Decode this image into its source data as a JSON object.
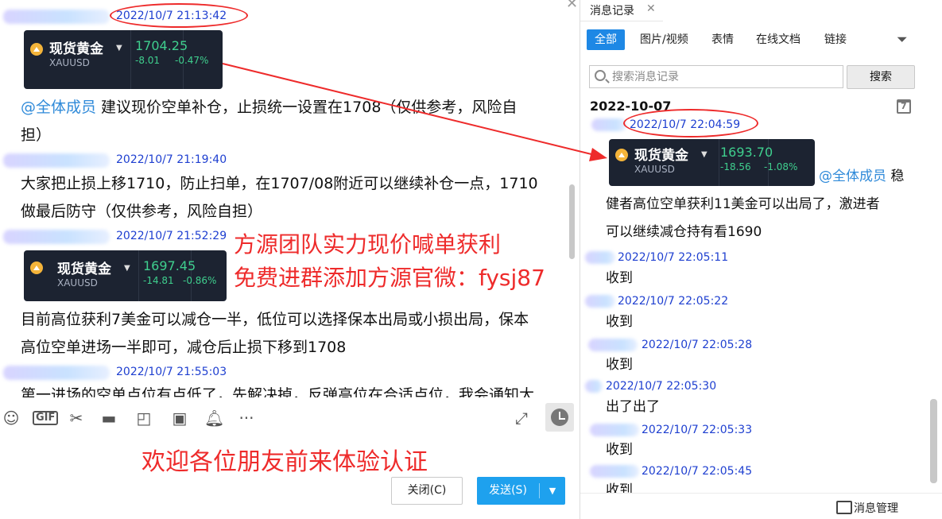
{
  "chat": {
    "messages": [
      {
        "timestamp": "2022/10/7 21:13:42",
        "card": {
          "name": "现货黄金",
          "code": "XAUUSD",
          "price": "1704.25",
          "change": "-8.01",
          "change_pct": "-0.47%"
        },
        "text_parts": [
          "@全体成员",
          " 建议现价空单补仓，止损统一设置在1708（仅供参考，风险自",
          "担）"
        ]
      },
      {
        "timestamp": "2022/10/7 21:19:40",
        "text_lines": [
          "大家把止损上移1710，防止扫单，在1707/08附近可以继续补仓一点，1710",
          "做最后防守（仅供参考，风险自担）"
        ]
      },
      {
        "timestamp": "2022/10/7 21:52:29",
        "card": {
          "name": "现货黄金",
          "code": "XAUUSD",
          "price": "1697.45",
          "change": "-14.81",
          "change_pct": "-0.86%"
        },
        "text_lines": [
          "目前高位获利7美金可以减仓一半，低位可以选择保本出局或小损出局，保本",
          "高位空单进场一半即可，减仓后止损下移到1708"
        ]
      },
      {
        "timestamp": "2022/10/7 21:55:03",
        "text_lines": [
          "第一进场的空单点位有点低了，先解决掉，反弹高位在合适点位，我会通知大"
        ]
      }
    ],
    "promo_lines": [
      "方源团队实力现价喊单获利",
      "免费进群添加方源官微：fysj87"
    ],
    "welcome": "欢迎各位朋友前来体验认证",
    "close_label": "关闭(C)",
    "send_label": "发送(S)",
    "toolbar_icons": [
      "emoji-icon",
      "gif-icon",
      "scissors-icon",
      "folder-icon",
      "screenshot-icon",
      "image-icon",
      "bell-icon",
      "more-icon"
    ]
  },
  "history": {
    "tab_title": "消息记录",
    "filters": [
      "全部",
      "图片/视频",
      "表情",
      "在线文档",
      "链接"
    ],
    "search_placeholder": "搜索消息记录",
    "search_button": "搜索",
    "date_header": "2022-10-07",
    "first": {
      "timestamp": "2022/10/7 22:04:59",
      "card": {
        "name": "现货黄金",
        "code": "XAUUSD",
        "price": "1693.70",
        "change": "-18.56",
        "change_pct": "-1.08%"
      },
      "mention": "@全体成员",
      "tail": " 稳",
      "lines": [
        "健者高位空单获利11美金可以出局了，激进者",
        "可以继续减仓持有看1690"
      ]
    },
    "entries": [
      {
        "timestamp": "2022/10/7 22:05:11",
        "text": "收到"
      },
      {
        "timestamp": "2022/10/7 22:05:22",
        "text": "收到"
      },
      {
        "timestamp": "2022/10/7 22:05:28",
        "text": "收到"
      },
      {
        "timestamp": "2022/10/7 22:05:30",
        "text": "出了出了"
      },
      {
        "timestamp": "2022/10/7 22:05:33",
        "text": "收到"
      },
      {
        "timestamp": "2022/10/7 22:05:45",
        "text": "收到"
      }
    ],
    "footer_label": "消息管理"
  },
  "colors": {
    "accent": "#1e88e5",
    "send": "#1ea1ee",
    "annotation": "#ee2b2b",
    "timestamp": "#1e3fd0",
    "gain": "#3fcf8e",
    "card_bg": "#1c2331"
  }
}
